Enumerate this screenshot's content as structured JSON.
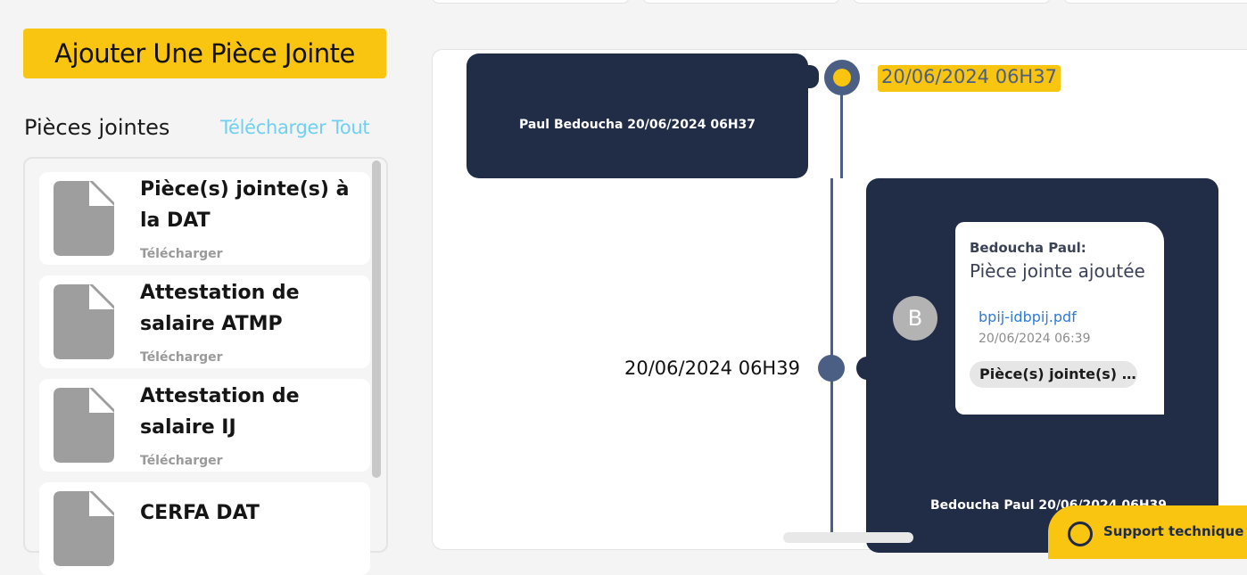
{
  "left": {
    "add_button_label": "Ajouter Une Pièce Jointe",
    "section_title": "Pièces jointes",
    "download_all_label": "Télécharger Tout",
    "attachments": [
      {
        "name": "Pièce(s) jointe(s) à la DAT",
        "action": "Télécharger"
      },
      {
        "name": "Attestation de salaire ATMP",
        "action": "Télécharger"
      },
      {
        "name": "Attestation de salaire IJ",
        "action": "Télécharger"
      },
      {
        "name": "CERFA DAT",
        "action": ""
      }
    ],
    "icon": "file-icon"
  },
  "timeline": {
    "event1": {
      "caption": "Paul Bedoucha 20/06/2024 06H37",
      "date": "20/06/2024 06H37"
    },
    "event2": {
      "date": "20/06/2024 06H39",
      "avatar_initial": "B",
      "message": {
        "author": "Bedoucha Paul:",
        "action": "Pièce jointe ajoutée",
        "file_link": "bpij-idbpij.pdf",
        "timestamp": "20/06/2024 06:39",
        "chip_label": "Pièce(s) jointe(s) à la DAT"
      },
      "caption": "Bedoucha Paul 20/06/2024 06H39"
    }
  },
  "support": {
    "label": "Support technique",
    "icon": "chat-bubble-icon"
  },
  "colors": {
    "accent": "#fac511",
    "card_dark": "#212c46",
    "timeline": "#4a5f83",
    "link_light": "#6fd1ef",
    "link": "#2e7bd6"
  }
}
